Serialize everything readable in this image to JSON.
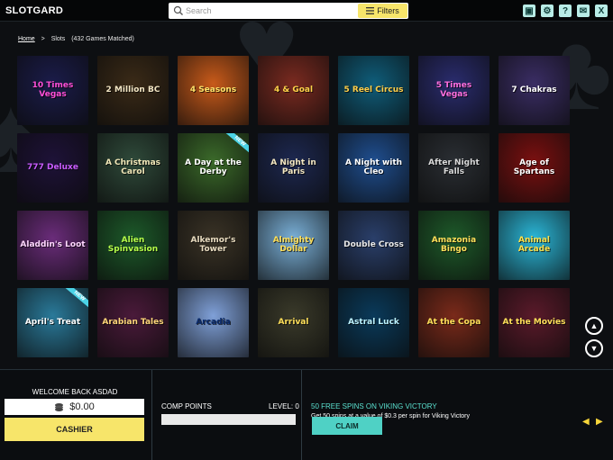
{
  "app": {
    "logo": "SLOTGARD"
  },
  "search": {
    "placeholder": "Search",
    "filters_label": "Filters"
  },
  "top_icons": [
    {
      "name": "save-icon",
      "glyph": "▣"
    },
    {
      "name": "gear-icon",
      "glyph": "⚙"
    },
    {
      "name": "help-icon",
      "glyph": "?"
    },
    {
      "name": "chat-icon",
      "glyph": "✉"
    },
    {
      "name": "close-icon",
      "glyph": "X"
    }
  ],
  "breadcrumb": {
    "home": "Home",
    "sep": ">",
    "slots": "Slots",
    "count": "(432 Games Matched)"
  },
  "games": [
    {
      "title": "10 Times Vegas",
      "bg": "#1b1c4a",
      "fg": "#ff4fd8",
      "new": false
    },
    {
      "title": "2 Million BC",
      "bg": "#3a2a17",
      "fg": "#f3e6c4",
      "new": false
    },
    {
      "title": "4 Seasons",
      "bg": "#c85a1a",
      "fg": "#ffe36a",
      "new": false
    },
    {
      "title": "4 & Goal",
      "bg": "#7a2a20",
      "fg": "#ffd34a",
      "new": false
    },
    {
      "title": "5 Reel Circus",
      "bg": "#0f5d7a",
      "fg": "#ffcf4a",
      "new": false
    },
    {
      "title": "5 Times Vegas",
      "bg": "#2a2c6e",
      "fg": "#ff6fe0",
      "new": false
    },
    {
      "title": "7 Chakras",
      "bg": "#3a2d64",
      "fg": "#ffffff",
      "new": false
    },
    {
      "title": "777 Deluxe",
      "bg": "#1e1238",
      "fg": "#c95cff",
      "new": false
    },
    {
      "title": "A Christmas Carol",
      "bg": "#2f4a3a",
      "fg": "#f1e7b8",
      "new": false
    },
    {
      "title": "A Day at the Derby",
      "bg": "#3b6a2a",
      "fg": "#ffffff",
      "new": true
    },
    {
      "title": "A Night in Paris",
      "bg": "#1d2850",
      "fg": "#f3e7c2",
      "new": false
    },
    {
      "title": "A Night with Cleo",
      "bg": "#1f4e8f",
      "fg": "#ffffff",
      "new": false
    },
    {
      "title": "After Night Falls",
      "bg": "#2a2e33",
      "fg": "#d9d9d9",
      "new": false
    },
    {
      "title": "Age of Spartans",
      "bg": "#7a1010",
      "fg": "#ffffff",
      "new": false
    },
    {
      "title": "Aladdin's Loot",
      "bg": "#6a2c7a",
      "fg": "#ffd7ff",
      "new": false
    },
    {
      "title": "Alien Spinvasion",
      "bg": "#1d5a2a",
      "fg": "#b6ff4a",
      "new": false
    },
    {
      "title": "Alkemor's Tower",
      "bg": "#3a3326",
      "fg": "#e9dcc0",
      "new": false
    },
    {
      "title": "Almighty Dollar",
      "bg": "#7ab0d8",
      "fg": "#ffe05a",
      "new": false
    },
    {
      "title": "Double Cross",
      "bg": "#2a3f6a",
      "fg": "#e9e9e9",
      "new": false
    },
    {
      "title": "Amazonia Bingo",
      "bg": "#1e5a2a",
      "fg": "#ffe05a",
      "new": false
    },
    {
      "title": "Animal Arcade",
      "bg": "#2bb7d8",
      "fg": "#ffe14a",
      "new": false
    },
    {
      "title": "April's Treat",
      "bg": "#2a7a9a",
      "fg": "#ffffff",
      "new": true
    },
    {
      "title": "Arabian Tales",
      "bg": "#4a1a3a",
      "fg": "#ffd77a",
      "new": false
    },
    {
      "title": "Arcadia",
      "bg": "#7fa0d8",
      "fg": "#0a2a6a",
      "new": false
    },
    {
      "title": "Arrival",
      "bg": "#3a3a2a",
      "fg": "#ffe05a",
      "new": false
    },
    {
      "title": "Astral Luck",
      "bg": "#0a3a5a",
      "fg": "#bdf3ff",
      "new": false
    },
    {
      "title": "At the Copa",
      "bg": "#7a2a1a",
      "fg": "#ffe05a",
      "new": false
    },
    {
      "title": "At the Movies",
      "bg": "#5a1a2a",
      "fg": "#ffe05a",
      "new": false
    }
  ],
  "new_badge_label": "NEW",
  "scroll": {
    "up": "▲",
    "down": "▼"
  },
  "account": {
    "welcome": "WELCOME BACK ASDAD",
    "balance": "$0.00",
    "cashier_label": "CASHIER"
  },
  "comp": {
    "label": "COMP POINTS",
    "level": "LEVEL: 0",
    "progress": 0
  },
  "promo": {
    "title": "50 FREE SPINS ON VIKING VICTORY",
    "text": "Get 50 spins at a value of $0.3 per spin for Viking Victory",
    "claim_label": "CLAIM",
    "prev": "◀",
    "next": "▶"
  },
  "colors": {
    "accent_yellow": "#f7e56a",
    "accent_teal": "#4fd1c5",
    "bg": "#0d0f12"
  }
}
